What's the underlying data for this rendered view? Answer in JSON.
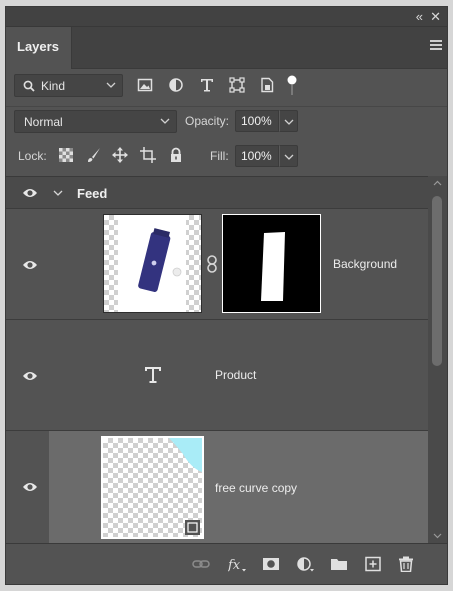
{
  "window": {
    "collapse_icon": "double-chevron-left-icon",
    "close_icon": "close-icon"
  },
  "panel": {
    "tab_label": "Layers"
  },
  "filter": {
    "kind_label": "Kind",
    "icons": [
      "image-filter-icon",
      "adjustment-filter-icon",
      "type-filter-icon",
      "shape-filter-icon",
      "smart-object-filter-icon",
      "filter-toggle-icon"
    ]
  },
  "blend": {
    "mode": "Normal",
    "opacity_label": "Opacity:",
    "opacity_value": "100%"
  },
  "lock": {
    "label": "Lock:",
    "fill_label": "Fill:",
    "fill_value": "100%",
    "icons": [
      "lock-transparency-icon",
      "lock-pixels-icon",
      "lock-position-icon",
      "lock-artboard-icon",
      "lock-all-icon"
    ]
  },
  "layers": {
    "group": {
      "name": "Feed",
      "visible": true,
      "expanded": true
    },
    "items": [
      {
        "name": "Background",
        "type": "masked-image",
        "visible": true,
        "selected": false
      },
      {
        "name": "Product",
        "type": "text",
        "visible": true,
        "selected": false
      },
      {
        "name": "free curve copy",
        "type": "smart-object",
        "visible": true,
        "selected": true
      }
    ]
  },
  "bottom_icons": [
    "link-layers-icon",
    "layer-style-icon",
    "add-mask-icon",
    "new-adjustment-icon",
    "new-group-icon",
    "new-layer-icon",
    "delete-layer-icon"
  ],
  "colors": {
    "panel_bg": "#535353",
    "selected_row": "#6b6b6b",
    "thumb_accent": "#a9ecf7",
    "product_purple": "#3a3a8c"
  }
}
